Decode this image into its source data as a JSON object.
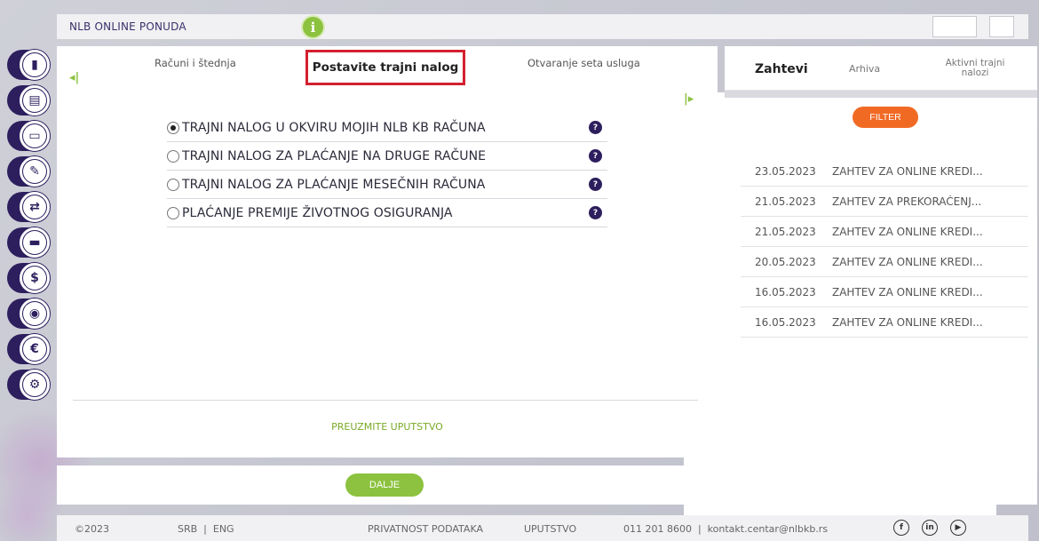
{
  "header": {
    "brand": "NLB ONLINE PONUDA",
    "info_icon": "info-icon",
    "colors": {
      "green": "#8cc23f",
      "purple": "#2d1f5e",
      "orange": "#f16a24",
      "red_highlight": "#d32030"
    }
  },
  "sidebar": {
    "items": [
      {
        "icon": "chart-icon",
        "glyph": "▮"
      },
      {
        "icon": "documents-icon",
        "glyph": "▤"
      },
      {
        "icon": "card-icon",
        "glyph": "▭"
      },
      {
        "icon": "signature-icon",
        "glyph": "✎"
      },
      {
        "icon": "transfer-icon",
        "glyph": "⇄"
      },
      {
        "icon": "minus-card-icon",
        "glyph": "▬"
      },
      {
        "icon": "dollar-icon",
        "glyph": "$"
      },
      {
        "icon": "location-icon",
        "glyph": "◉"
      },
      {
        "icon": "euro-icon",
        "glyph": "€"
      },
      {
        "icon": "settings-icon",
        "glyph": "⚙"
      }
    ]
  },
  "main": {
    "tabs": {
      "prev": "Računi i štednja",
      "active": "Postavite trajni nalog",
      "next": "Otvaranje seta usluga"
    },
    "options": [
      {
        "label": "TRAJNI NALOG U OKVIRU MOJIH NLB KB RAČUNA",
        "checked": true
      },
      {
        "label": "TRAJNI NALOG ZA PLAĆANJE NA DRUGE RAČUNE",
        "checked": false
      },
      {
        "label": "TRAJNI NALOG ZA PLAĆANJE MESEČNIH RAČUNA",
        "checked": false
      },
      {
        "label": "PLAĆANJE PREMIJE ŽIVOTNOG OSIGURANJA",
        "checked": false
      }
    ],
    "help_label": "?",
    "download_label": "PREUZMITE UPUTSTVO",
    "continue_label": "DALJE"
  },
  "right": {
    "tabs": {
      "requests": "Zahtevi",
      "archive": "Arhiva",
      "active_orders": "Aktivni trajni nalozi"
    },
    "filter_label": "FILTER",
    "requests": [
      {
        "date": "23.05.2023",
        "title": "ZAHTEV ZA ONLINE KREDI..."
      },
      {
        "date": "21.05.2023",
        "title": "ZAHTEV ZA PREKORAČENJ..."
      },
      {
        "date": "21.05.2023",
        "title": "ZAHTEV ZA ONLINE KREDI..."
      },
      {
        "date": "20.05.2023",
        "title": "ZAHTEV ZA ONLINE KREDI..."
      },
      {
        "date": "16.05.2023",
        "title": "ZAHTEV ZA ONLINE KREDI..."
      },
      {
        "date": "16.05.2023",
        "title": "ZAHTEV ZA ONLINE KREDI..."
      }
    ]
  },
  "footer": {
    "copyright": "©2023",
    "languages": "SRB  |  ENG",
    "privacy": "PRIVATNOST PODATAKA",
    "manual": "UPUTSTVO",
    "contact": "011 201 8600  |  kontakt.centar@nlbkb.rs",
    "social": [
      {
        "icon": "facebook-icon",
        "glyph": "f"
      },
      {
        "icon": "linkedin-icon",
        "glyph": "in"
      },
      {
        "icon": "youtube-icon",
        "glyph": "▶"
      }
    ]
  }
}
